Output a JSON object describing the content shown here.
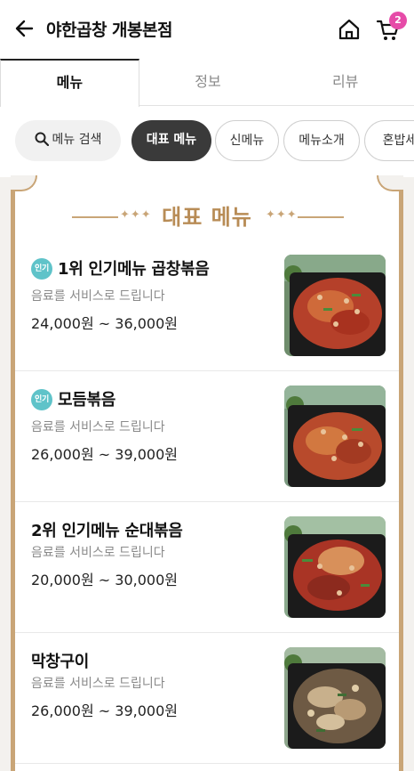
{
  "header": {
    "title": "야한곱창 개봉본점",
    "cart_count": "2"
  },
  "tabs": [
    {
      "label": "메뉴",
      "active": true
    },
    {
      "label": "정보",
      "active": false
    },
    {
      "label": "리뷰",
      "active": false
    }
  ],
  "chips": {
    "search": "메뉴 검색",
    "items": [
      "대표 메뉴",
      "신메뉴",
      "메뉴소개",
      "혼밥세"
    ]
  },
  "section": {
    "title": "대표 메뉴"
  },
  "menu": [
    {
      "badge": "인기",
      "name": "1위 인기메뉴 곱창볶음",
      "desc": "음료를 서비스로 드립니다",
      "price": "24,000원 ~ 36,000원"
    },
    {
      "badge": "인기",
      "name": "모듬볶음",
      "desc": "음료를 서비스로 드립니다",
      "price": "26,000원 ~ 39,000원"
    },
    {
      "badge": "",
      "name": "2위 인기메뉴 순대볶음",
      "desc": "음료를 서비스로 드립니다",
      "price": "20,000원 ~ 30,000원"
    },
    {
      "badge": "",
      "name": "막창구이",
      "desc": "음료를 서비스로 드립니다",
      "price": "26,000원 ~ 39,000원"
    }
  ],
  "colors": {
    "accent_gold": "#c9a577",
    "badge_pink": "#e64ba8",
    "popular_badge": "#5fc3c9",
    "active_chip": "#3a3a3a"
  }
}
